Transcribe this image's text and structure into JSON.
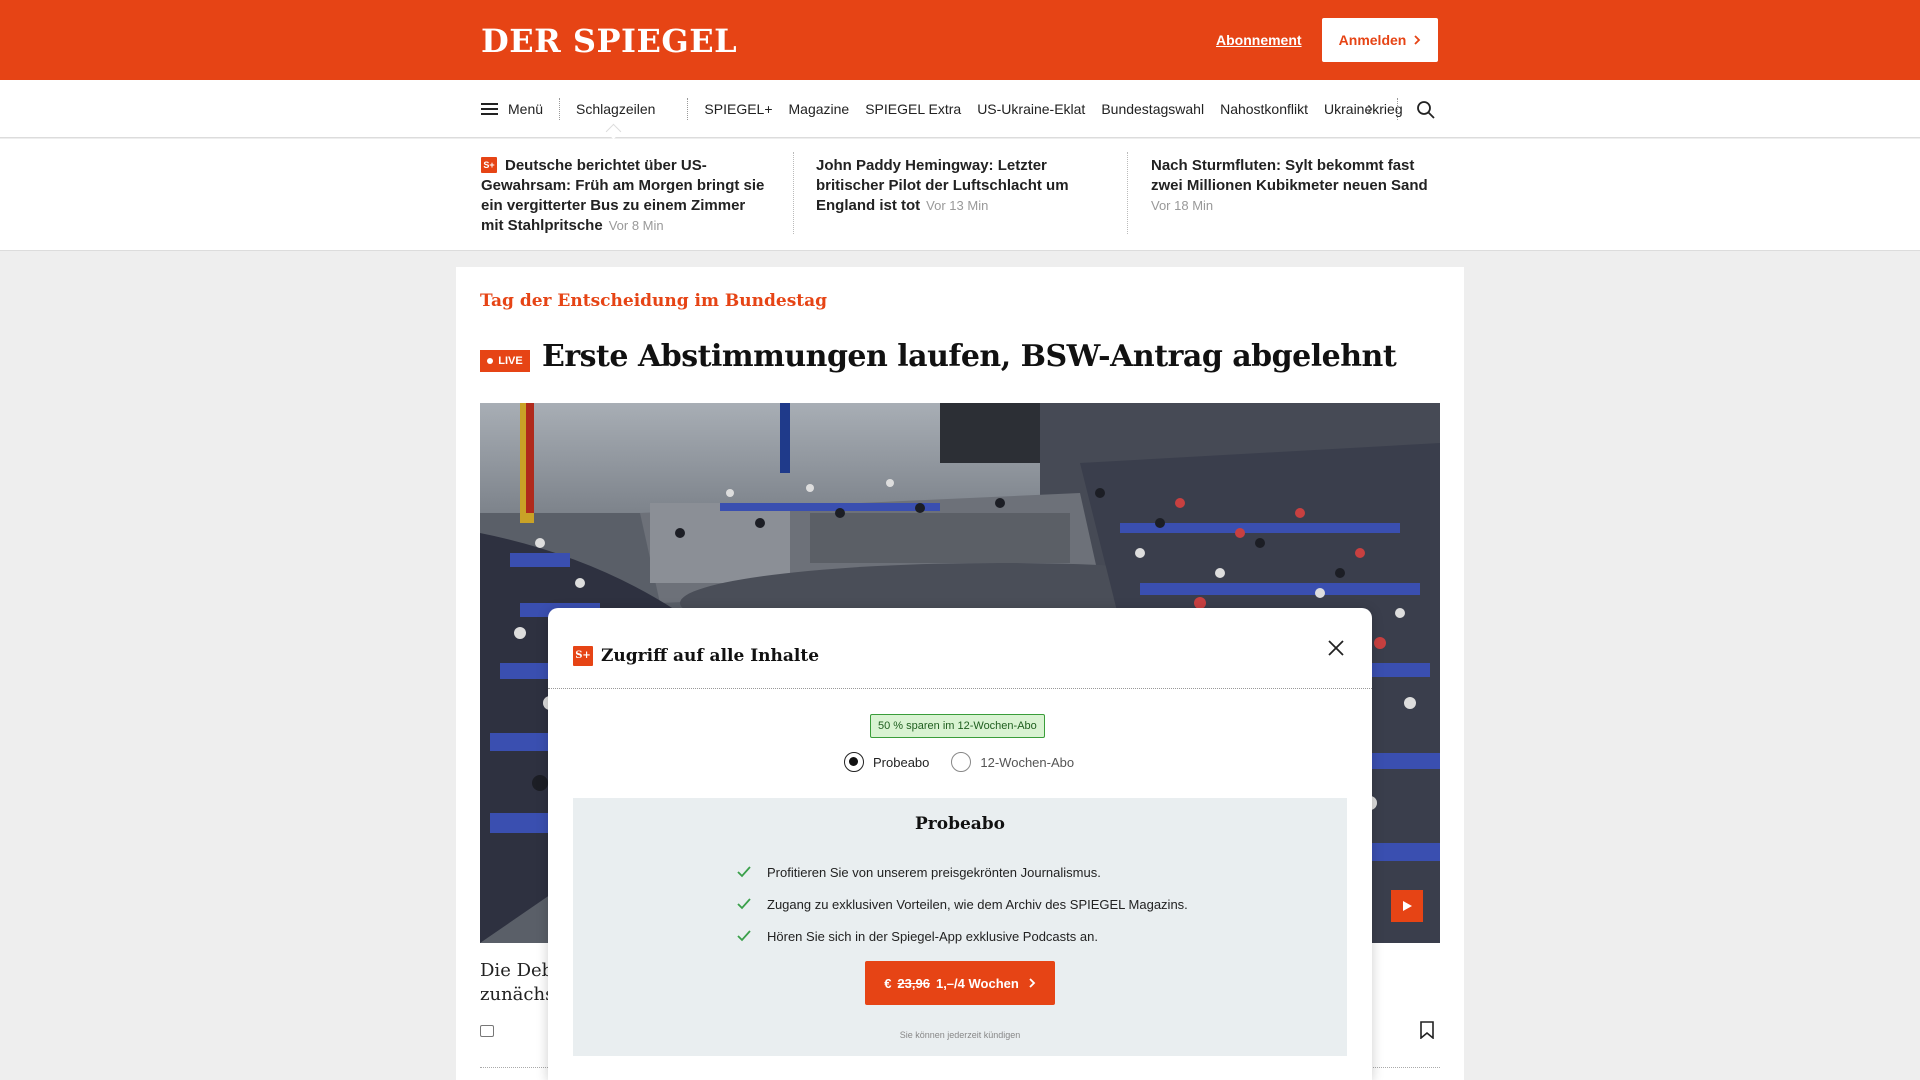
{
  "header": {
    "logo": "DER SPIEGEL",
    "subscription_link": "Abonnement",
    "login_button": "Anmelden",
    "brand_color": "#e64415"
  },
  "nav": {
    "menu_label": "Menü",
    "items": [
      "Schlagzeilen",
      "SPIEGEL+",
      "Magazine",
      "SPIEGEL Extra",
      "US-Ukraine-Eklat",
      "Bundestagswahl",
      "Nahostkonflikt",
      "Ukrainekrieg"
    ],
    "active": "Schlagzeilen"
  },
  "ticker": [
    {
      "badge": "S+",
      "title": "Deutsche berichtet über US-Gewahrsam: Früh am Morgen bringt sie ein vergitterter Bus zu einem Zimmer mit Stahlpritsche",
      "time": "Vor 8 Min"
    },
    {
      "title": "John Paddy Hemingway: Letzter britischer Pilot der Luftschlacht um England ist tot",
      "time": "Vor 13 Min"
    },
    {
      "title": "Nach Sturmfluten: Sylt bekommt fast zwei Millionen Kubikmeter neuen Sand",
      "time": "Vor 18 Min"
    }
  ],
  "article": {
    "kicker": "Tag der Entscheidung im Bundestag",
    "live_badge": "LIVE",
    "headline": "Erste Abstimmungen laufen, BSW-Antrag abgelehnt",
    "teaser_line1": "Die Deba",
    "teaser_line2": "zunächst"
  },
  "modal": {
    "badge": "S+",
    "title": "Zugriff auf alle Inhalte",
    "savings_badge": "50 % sparen im 12-Wochen-Abo",
    "options": [
      {
        "label": "Probeabo",
        "selected": true
      },
      {
        "label": "12-Wochen-Abo",
        "selected": false
      }
    ],
    "plan_title": "Probeabo",
    "benefits": [
      "Profitieren Sie von unserem preisgekrönten Journalismus.",
      "Zugang zu exklusiven Vorteilen, wie dem Archiv des SPIEGEL Magazins.",
      "Hören Sie sich in der Spiegel-App exklusive Podcasts an."
    ],
    "cta_currency": "€",
    "cta_old_price": "23,96",
    "cta_new_price": "1,–/4 Wochen",
    "cancel_note": "Sie können jederzeit kündigen"
  }
}
